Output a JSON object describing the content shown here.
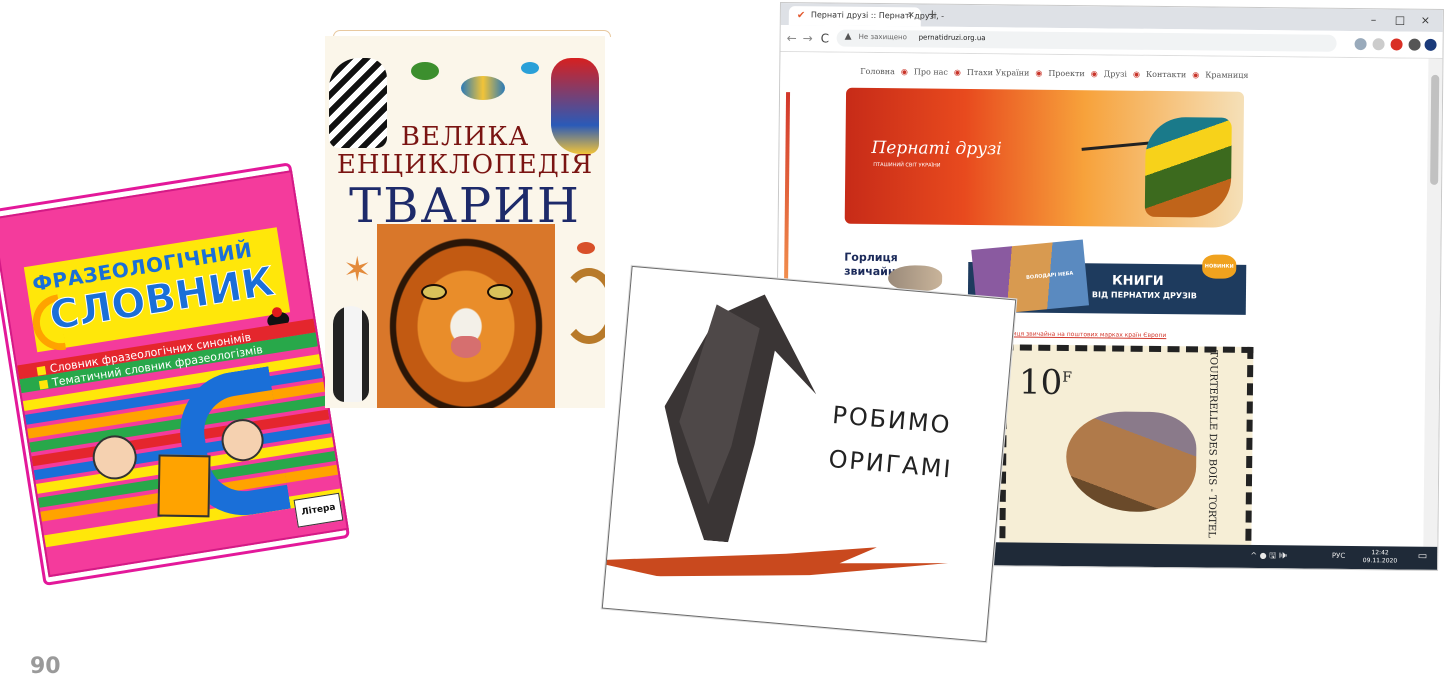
{
  "dictionary": {
    "title_line1": "ФРАЗЕОЛОГІЧНИЙ",
    "title_line2": "СЛОВНИК",
    "subtitle_1": "Словник фразеологічних синонімів",
    "subtitle_2": "Тематичний словник фразеологізмів",
    "publisher_logo": "Літера"
  },
  "encyclopedia": {
    "title_line1": "ВЕЛИКА",
    "title_line2": "ЕНЦИКЛОПЕДІЯ",
    "title_line3": "ТВАРИН"
  },
  "browser": {
    "tab_title": "Пернаті друзі :: Пернаті друзі, -",
    "tab_close": "×",
    "new_tab": "+",
    "window_controls": [
      "–",
      "□",
      "×"
    ],
    "nav": {
      "back": "←",
      "forward": "→",
      "reload": "C"
    },
    "security_label": "Не захищено",
    "url": "pernatidruzi.org.ua",
    "menu": [
      "Головна",
      "Про нас",
      "Птахи України",
      "Проекти",
      "Друзі",
      "Контакти",
      "Крамниця"
    ],
    "banner_logo": "Пернаті друзі",
    "banner_logo_sub": "ПТАШИНИЙ СВІТ УКРАЇНИ",
    "dove_label_line1": "Горлиця",
    "dove_label_line2": "звичайна",
    "books_title": "КНИГИ",
    "books_subtitle": "ВІД ПЕРНАТИХ ДРУЗІВ",
    "books_badge": "НОВИНКИ",
    "books_cover_text": "ВОЛОДАРІ НЕБА",
    "caption_link": "Горлиця звичайна на поштових марках країн Європи",
    "stamp_value": "10",
    "stamp_value_sup": "F",
    "stamp_vertical_text": "TOURTERELLE DES BOIS - TORTEL",
    "taskbar_lang": "РУС",
    "taskbar_time": "12:42",
    "taskbar_date": "09.11.2020",
    "taskbar_tray": "^ ● 🖫 🕪"
  },
  "origami": {
    "line1": "РОБИМО",
    "line2": "ОРИГАМІ"
  },
  "page_number": "90",
  "colors": {
    "dictionary_pink": "#f43b9c",
    "dictionary_blue": "#1a6fd8",
    "encyclopedia_red": "#7a1412",
    "encyclopedia_navy": "#1d2a6a",
    "origami_orange": "#c9491e",
    "banner_red": "#e84a1e"
  }
}
